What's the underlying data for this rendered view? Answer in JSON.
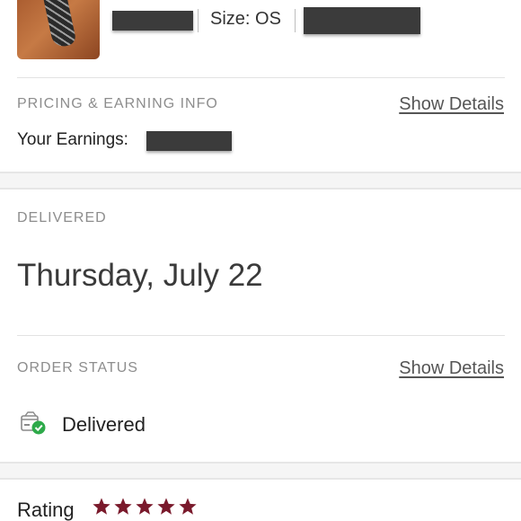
{
  "product": {
    "size_text": "Size: OS",
    "thumbnail_icon": "sock-product-thumbnail"
  },
  "pricing": {
    "section_label": "PRICING & EARNING INFO",
    "show_details_label": "Show Details",
    "earnings_label": "Your Earnings:"
  },
  "delivered": {
    "section_label": "DELIVERED",
    "date": "Thursday, July 22"
  },
  "order_status": {
    "section_label": "ORDER STATUS",
    "show_details_label": "Show Details",
    "status_text": "Delivered",
    "status_icon": "delivered-box-check-icon"
  },
  "rating": {
    "label": "Rating",
    "stars": 5,
    "star_color": "#7a1a2c"
  },
  "colors": {
    "check_green": "#2eaa4a",
    "redaction": "#3b3b3b"
  }
}
